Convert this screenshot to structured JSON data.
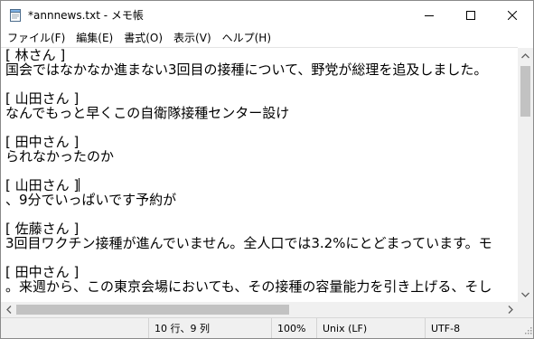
{
  "window": {
    "title": "*annnews.txt - メモ帳",
    "minimize_icon": "minimize-icon",
    "maximize_icon": "maximize-icon",
    "close_icon": "close-icon"
  },
  "menu": {
    "items": [
      {
        "label": "ファイル(F)"
      },
      {
        "label": "編集(E)"
      },
      {
        "label": "書式(O)"
      },
      {
        "label": "表示(V)"
      },
      {
        "label": "ヘルプ(H)"
      }
    ]
  },
  "editor": {
    "lines": [
      "[ 林さん ]",
      "国会ではなかなか進まない3回目の接種について、野党が総理を追及しました。",
      "",
      "[ 山田さん ]",
      "なんでもっと早くこの自衛隊接種センター設け",
      "",
      "[ 田中さん ]",
      "られなかったのか",
      "",
      "[ 山田さん ]",
      "、9分でいっぱいです予約が",
      "",
      "[ 佐藤さん ]",
      "3回目ワクチン接種が進んでいません。全人口では3.2%にとどまっています。モ",
      "",
      "[ 田中さん ]",
      "。来週から、この東京会場においても、その接種の容量能力を引き上げる、そし"
    ],
    "caret_line": 9
  },
  "status": {
    "position": "10 行、9 列",
    "zoom": "100%",
    "line_ending": "Unix (LF)",
    "encoding": "UTF-8"
  },
  "colors": {
    "scroll_track": "#f0f0f0",
    "scroll_thumb": "#c2c2c2",
    "statusbar_bg": "#f0f0f0"
  }
}
